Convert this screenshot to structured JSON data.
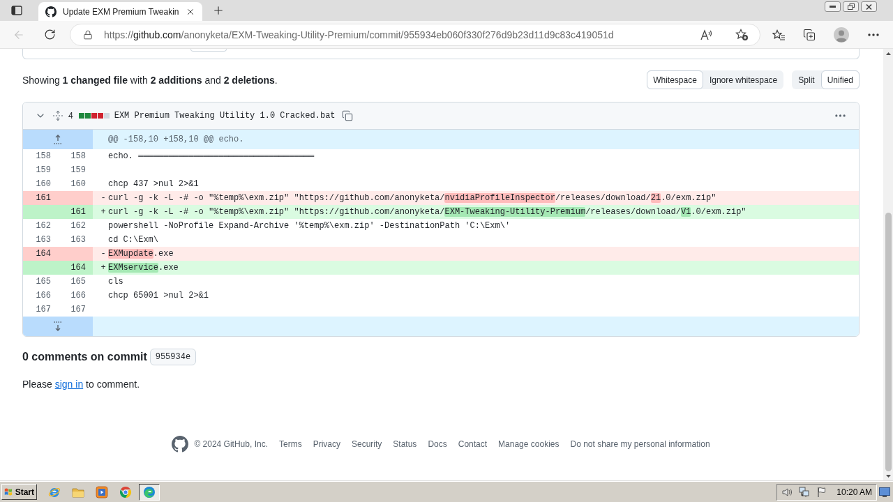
{
  "browser": {
    "tabs": [
      {
        "title": "Update EXM Premium Tweakin",
        "selected": true
      }
    ],
    "back_button": {
      "disabled": true
    },
    "address": {
      "scheme": "https://",
      "host": "github.com",
      "path": "/anonyketa/EXM-Tweaking-Utility-Premium/commit/955934eb060f330f276d9b23d11d9c83c419051d"
    }
  },
  "diff_summary": "Showing **1 changed file** with **2 additions** and **2 deletions**.",
  "whitespace_options": [
    {
      "label": "Whitespace",
      "selected": true
    },
    {
      "label": "Ignore whitespace",
      "selected": false
    }
  ],
  "view_options": [
    {
      "label": "Split",
      "selected": false
    },
    {
      "label": "Unified",
      "selected": true
    }
  ],
  "file": {
    "expanded": true,
    "changes": "4",
    "diffstat": [
      {
        "color": "#1f883d"
      },
      {
        "color": "#1f883d"
      },
      {
        "color": "#cf222e"
      },
      {
        "color": "#cf222e"
      },
      {
        "color": "#d1d9e0"
      }
    ],
    "name": "EXM Premium Tweaking Utility 1.0 Cracked.bat",
    "hunk_header": "@@ -158,10 +158,10 @@ echo.",
    "lines": [
      {
        "kind": "context",
        "old": "158",
        "new": "158",
        "code": [
          {
            "text": "echo. ═══════════════════════════════════",
            "changed": false
          }
        ]
      },
      {
        "kind": "context",
        "old": "159",
        "new": "159"
      },
      {
        "kind": "context",
        "old": "160",
        "new": "160",
        "code": [
          {
            "text": "chcp 437 >nul 2>&1",
            "changed": false
          }
        ]
      },
      {
        "kind": "deletion",
        "old": "161",
        "marker": "-",
        "code": [
          {
            "text": "curl -g -k -L -# -o \"%temp%\\exm.zip\" \"https://github.com/anonyketa/",
            "changed": false
          },
          {
            "text": "nvidiaProfileInspector",
            "changed": true
          },
          {
            "text": "/releases/download/",
            "changed": false
          },
          {
            "text": "21",
            "changed": true
          },
          {
            "text": ".0/exm.zip\"",
            "changed": false
          }
        ]
      },
      {
        "kind": "addition",
        "new": "161",
        "marker": "+",
        "code": [
          {
            "text": "curl -g -k -L -# -o \"%temp%\\exm.zip\" \"https://github.com/anonyketa/",
            "changed": false
          },
          {
            "text": "EXM-Tweaking-Utility-Premium",
            "changed": true
          },
          {
            "text": "/releases/download/",
            "changed": false
          },
          {
            "text": "V1",
            "changed": true
          },
          {
            "text": ".0/exm.zip\"",
            "changed": false
          }
        ]
      },
      {
        "kind": "context",
        "old": "162",
        "new": "162",
        "code": [
          {
            "text": "powershell -NoProfile Expand-Archive '%temp%\\exm.zip' -DestinationPath 'C:\\Exm\\'",
            "changed": false
          }
        ]
      },
      {
        "kind": "context",
        "old": "163",
        "new": "163",
        "code": [
          {
            "text": "cd C:\\Exm\\",
            "changed": false
          }
        ]
      },
      {
        "kind": "deletion",
        "old": "164",
        "marker": "-",
        "code": [
          {
            "text": "EXMupdate",
            "changed": true
          },
          {
            "text": ".exe",
            "changed": false
          }
        ]
      },
      {
        "kind": "addition",
        "new": "164",
        "marker": "+",
        "code": [
          {
            "text": "EXMservice",
            "changed": true
          },
          {
            "text": ".exe",
            "changed": false
          }
        ]
      },
      {
        "kind": "context",
        "old": "165",
        "new": "165",
        "code": [
          {
            "text": "cls",
            "changed": false
          }
        ]
      },
      {
        "kind": "context",
        "old": "166",
        "new": "166",
        "code": [
          {
            "text": "chcp 65001 >nul 2>&1",
            "changed": false
          }
        ]
      },
      {
        "kind": "context",
        "old": "167",
        "new": "167"
      }
    ]
  },
  "comments": {
    "heading": "0 comments on commit",
    "commit": "955934e",
    "prompt_before": "Please",
    "link": "sign in",
    "prompt_after": "to comment."
  },
  "footer": {
    "copyright": "© 2024 GitHub, Inc.",
    "links": [
      "Terms",
      "Privacy",
      "Security",
      "Status",
      "Docs",
      "Contact",
      "Manage cookies",
      "Do not share my personal information"
    ]
  },
  "taskbar": {
    "start": "Start",
    "apps": [
      {
        "kind": "ie",
        "selected": false
      },
      {
        "kind": "folder",
        "selected": false
      },
      {
        "kind": "player",
        "selected": false
      },
      {
        "kind": "chrome",
        "selected": false
      },
      {
        "kind": "edge",
        "selected": true
      }
    ],
    "clock": "10:20 AM"
  }
}
